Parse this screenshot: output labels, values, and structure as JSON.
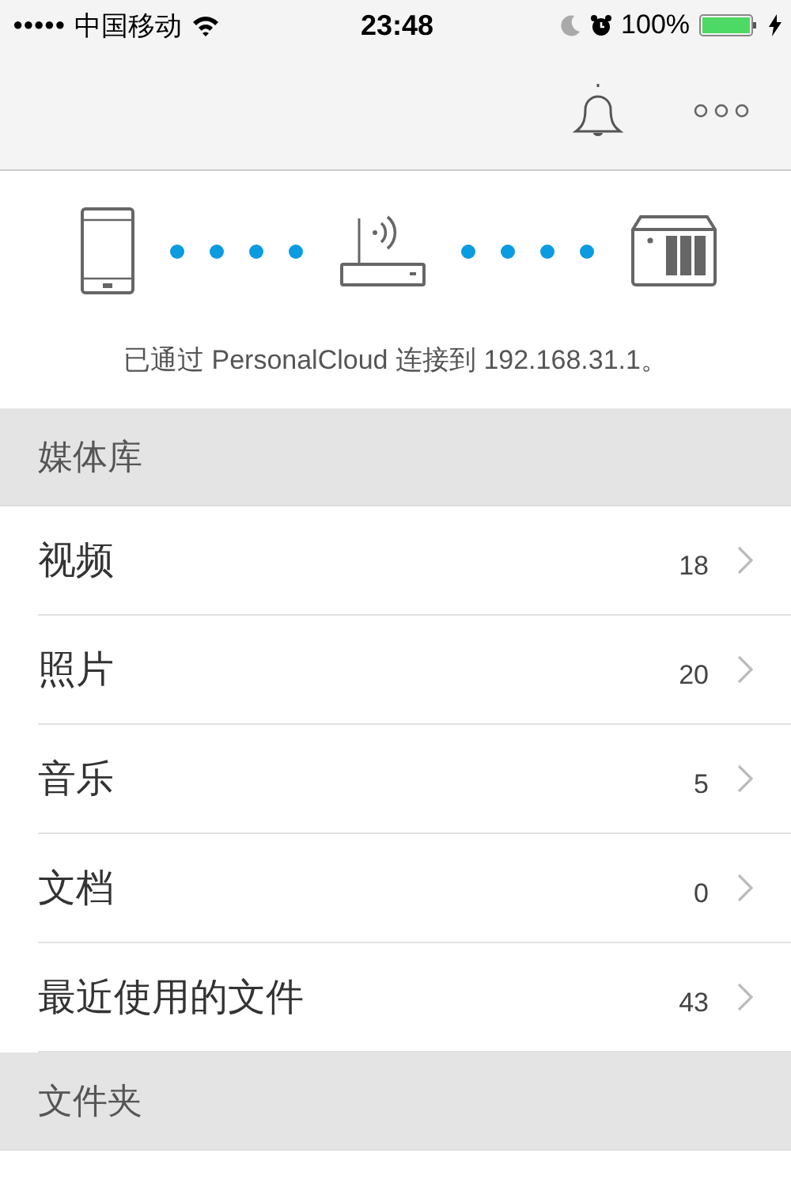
{
  "status_bar": {
    "signal_dots": "●●●●●",
    "carrier": "中国移动",
    "time": "23:48",
    "battery": "100%"
  },
  "connection": {
    "message": "已通过 PersonalCloud 连接到 192.168.31.1。"
  },
  "sections": [
    {
      "title": "媒体库",
      "items": [
        {
          "label": "视频",
          "count": "18"
        },
        {
          "label": "照片",
          "count": "20"
        },
        {
          "label": "音乐",
          "count": "5"
        },
        {
          "label": "文档",
          "count": "0"
        },
        {
          "label": "最近使用的文件",
          "count": "43"
        }
      ]
    },
    {
      "title": "文件夹"
    }
  ]
}
